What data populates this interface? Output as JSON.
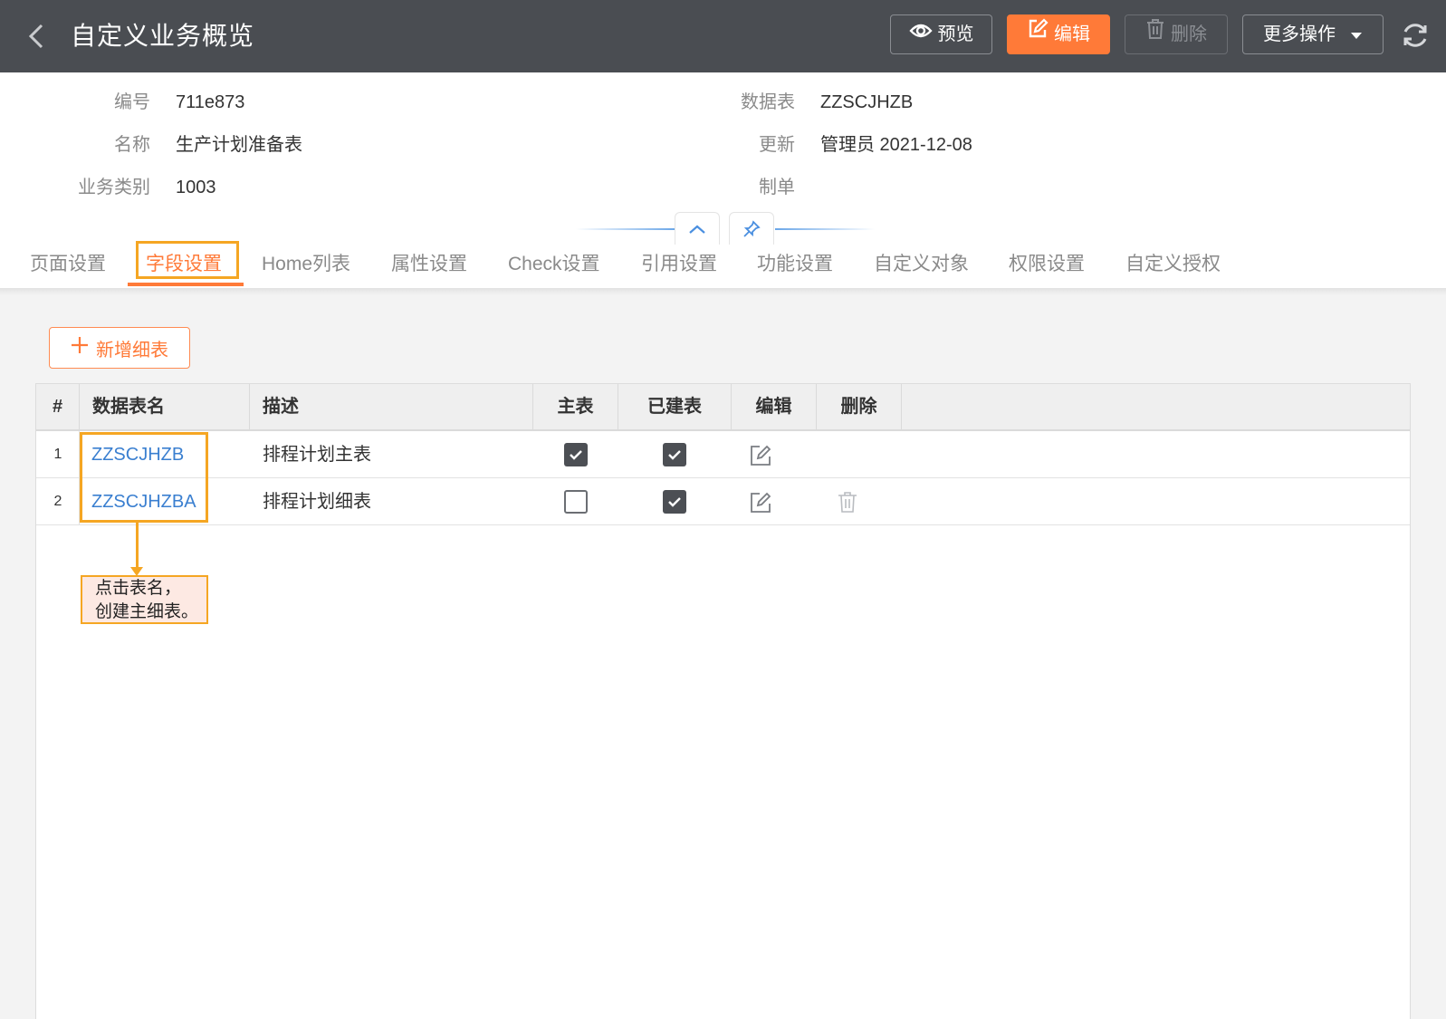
{
  "header": {
    "title": "自定义业务概览",
    "preview_label": "预览",
    "edit_label": "编辑",
    "delete_label": "删除",
    "more_label": "更多操作"
  },
  "info": {
    "left": [
      {
        "label": "编号",
        "value": "711e873"
      },
      {
        "label": "名称",
        "value": "生产计划准备表"
      },
      {
        "label": "业务类别",
        "value": "1003"
      }
    ],
    "right": [
      {
        "label": "数据表",
        "value": "ZZSCJHZB"
      },
      {
        "label": "更新",
        "value": "管理员 2021-12-08"
      },
      {
        "label": "制单",
        "value": ""
      }
    ]
  },
  "tabs": [
    {
      "label": "页面设置"
    },
    {
      "label": "字段设置",
      "active": true
    },
    {
      "label": "Home列表"
    },
    {
      "label": "属性设置"
    },
    {
      "label": "Check设置"
    },
    {
      "label": "引用设置"
    },
    {
      "label": "功能设置"
    },
    {
      "label": "自定义对象"
    },
    {
      "label": "权限设置"
    },
    {
      "label": "自定义授权"
    }
  ],
  "main": {
    "add_detail_label": "新增细表"
  },
  "table": {
    "columns": [
      "#",
      "数据表名",
      "描述",
      "主表",
      "已建表",
      "编辑",
      "删除"
    ],
    "rows": [
      {
        "no": "1",
        "name": "ZZSCJHZB",
        "desc": "排程计划主表",
        "is_main": true,
        "built": true,
        "can_delete": false
      },
      {
        "no": "2",
        "name": "ZZSCJHZBA",
        "desc": "排程计划细表",
        "is_main": false,
        "built": true,
        "can_delete": true
      }
    ]
  },
  "annotation": {
    "line1": "点击表名，",
    "line2": "创建主细表。"
  },
  "colors": {
    "accent": "#ff7a38",
    "header_bg": "#4a4d52",
    "link": "#3a7fd0",
    "highlight": "#f5a623"
  }
}
